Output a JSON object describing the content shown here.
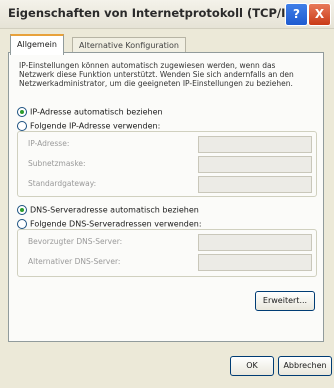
{
  "window": {
    "title": "Eigenschaften von Internetprotokoll (TCP/IP)",
    "help": "?",
    "close": "X"
  },
  "tabs": [
    {
      "label": "Allgemein"
    },
    {
      "label": "Alternative Konfiguration"
    }
  ],
  "description": "IP-Einstellungen können automatisch zugewiesen werden, wenn das Netzwerk diese Funktion unterstützt. Wenden Sie sich andernfalls an den Netzwerkadministrator, um die geeigneten IP-Einstellungen zu beziehen.",
  "ip": {
    "auto_label": "IP-Adresse automatisch beziehen",
    "manual_label": "Folgende IP-Adresse verwenden:",
    "fields": [
      {
        "label": "IP-Adresse:",
        "value": ""
      },
      {
        "label": "Subnetzmaske:",
        "value": ""
      },
      {
        "label": "Standardgateway:",
        "value": ""
      }
    ]
  },
  "dns": {
    "auto_label": "DNS-Serveradresse automatisch beziehen",
    "manual_label": "Folgende DNS-Serveradressen verwenden:",
    "fields": [
      {
        "label": "Bevorzugter DNS-Server:",
        "value": ""
      },
      {
        "label": "Alternativer DNS-Server:",
        "value": ""
      }
    ]
  },
  "buttons": {
    "advanced": "Erweitert...",
    "ok": "OK",
    "cancel": "Abbrechen"
  }
}
